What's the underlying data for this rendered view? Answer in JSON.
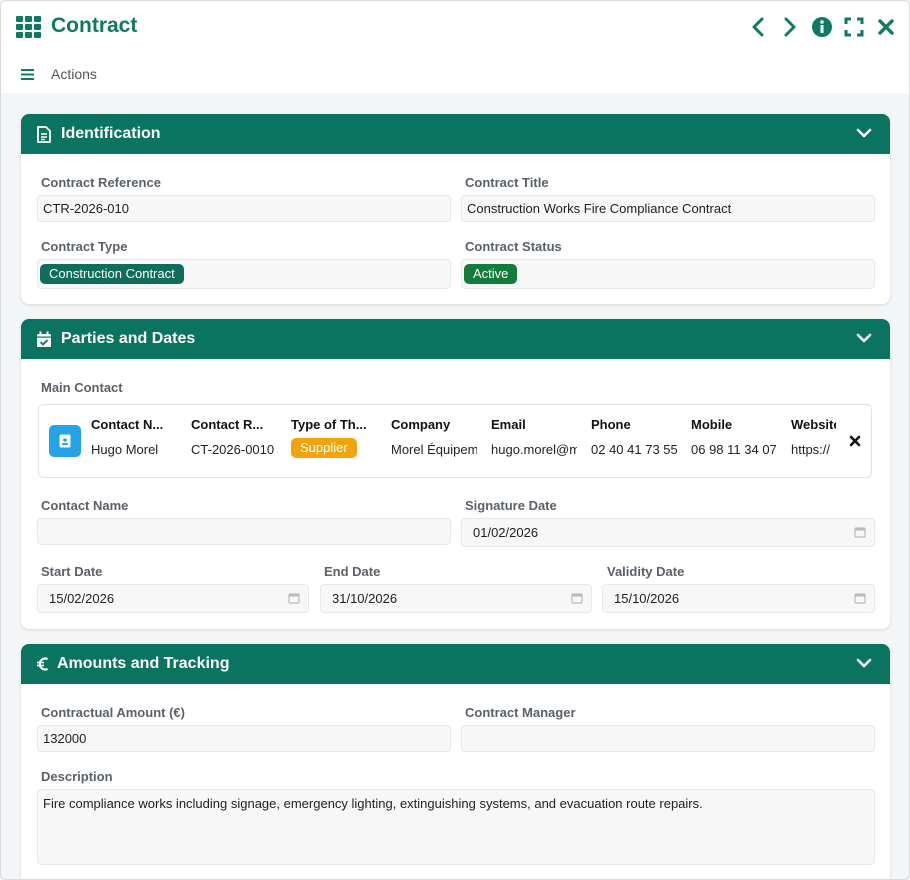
{
  "window": {
    "title": "Contract"
  },
  "toolbar": {
    "actions_label": "Actions"
  },
  "identification": {
    "title": "Identification",
    "reference_label": "Contract Reference",
    "reference_value": "CTR-2026-010",
    "title_label": "Contract Title",
    "title_value": "Construction Works Fire Compliance Contract",
    "type_label": "Contract Type",
    "type_value": "Construction Contract",
    "status_label": "Contract Status",
    "status_value": "Active"
  },
  "parties": {
    "title": "Parties and Dates",
    "main_contact_label": "Main Contact",
    "contact_card": {
      "columns": [
        {
          "header": "Contact N...",
          "value": "Hugo Morel"
        },
        {
          "header": "Contact R...",
          "value": "CT-2026-0010"
        },
        {
          "header": "Type of Th...",
          "value": "Supplier"
        },
        {
          "header": "Company",
          "value": "Morel Équipements"
        },
        {
          "header": "Email",
          "value": "hugo.morel@morel.fr"
        },
        {
          "header": "Phone",
          "value": "02 40 41 73 55"
        },
        {
          "header": "Mobile",
          "value": "06 98 11 34 07"
        },
        {
          "header": "Website",
          "value": "https://"
        }
      ]
    },
    "contact_name_label": "Contact Name",
    "contact_name_value": "",
    "signature_label": "Signature Date",
    "signature_value": "01/02/2026",
    "start_label": "Start Date",
    "start_value": "15/02/2026",
    "end_label": "End Date",
    "end_value": "31/10/2026",
    "validity_label": "Validity Date",
    "validity_value": "15/10/2026"
  },
  "amounts": {
    "title": "Amounts and Tracking",
    "amount_label": "Contractual Amount (€)",
    "amount_value": "132000",
    "manager_label": "Contract Manager",
    "manager_value": "",
    "description_label": "Description",
    "description_value": "Fire compliance works including signage, emergency lighting, extinguishing systems, and evacuation route repairs."
  },
  "icons": {
    "app": "grid-icon",
    "prev": "chevron-left-icon",
    "next": "chevron-right-icon",
    "info": "info-icon",
    "expand": "expand-icon",
    "close": "close-icon",
    "menu": "hamburger-icon",
    "identification": "document-icon",
    "parties": "calendar-check-icon",
    "amounts": "euro-icon",
    "collapse": "chevron-down-icon",
    "calendar": "calendar-icon"
  },
  "colors": {
    "accent": "#0a7460",
    "title": "#0f7a64",
    "active": "#127d3a",
    "supplier": "#f2a40e",
    "avatar": "#26a3e6"
  }
}
